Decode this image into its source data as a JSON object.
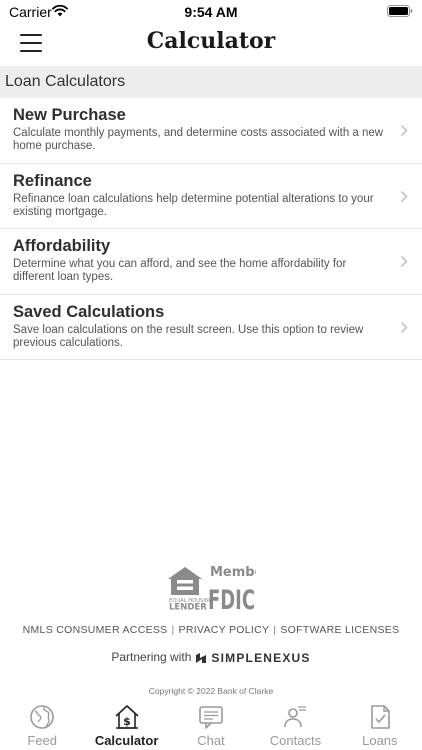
{
  "status_bar": {
    "carrier": "Carrier",
    "time": "9:54 AM"
  },
  "nav": {
    "title": "Calculator"
  },
  "section_header": "Loan Calculators",
  "items": [
    {
      "title": "New Purchase",
      "description": "Calculate monthly payments, and determine costs associated with a new home purchase."
    },
    {
      "title": "Refinance",
      "description": "Refinance loan calculations help determine potential alterations to your existing mortgage."
    },
    {
      "title": "Affordability",
      "description": "Determine what you can afford, and see the home affordability for different loan types."
    },
    {
      "title": "Saved Calculations",
      "description": "Save loan calculations on the result screen. Use this option to review previous calculations."
    }
  ],
  "footer": {
    "logo": {
      "member": "Member",
      "fdic": "FDIC",
      "ehl_line1": "EQUAL HOUSING",
      "ehl_line2": "LENDER"
    },
    "links": [
      "NMLS CONSUMER ACCESS",
      "PRIVACY POLICY",
      "SOFTWARE LICENSES"
    ],
    "separator": "|",
    "partnering": "Partnering with",
    "partner_brand": "SIMPLENEXUS",
    "copyright": "Copyright © 2022 Bank of Clarke"
  },
  "tabs": [
    {
      "label": "Feed",
      "icon": "globe-icon",
      "active": false
    },
    {
      "label": "Calculator",
      "icon": "house-dollar-icon",
      "active": true
    },
    {
      "label": "Chat",
      "icon": "chat-icon",
      "active": false
    },
    {
      "label": "Contacts",
      "icon": "contacts-icon",
      "active": false
    },
    {
      "label": "Loans",
      "icon": "document-check-icon",
      "active": false
    }
  ],
  "colors": {
    "active_tab": "#222222",
    "inactive_tab": "#9a9a9a",
    "section_bg": "#ededed",
    "logo_gray": "#8a8a8a"
  }
}
